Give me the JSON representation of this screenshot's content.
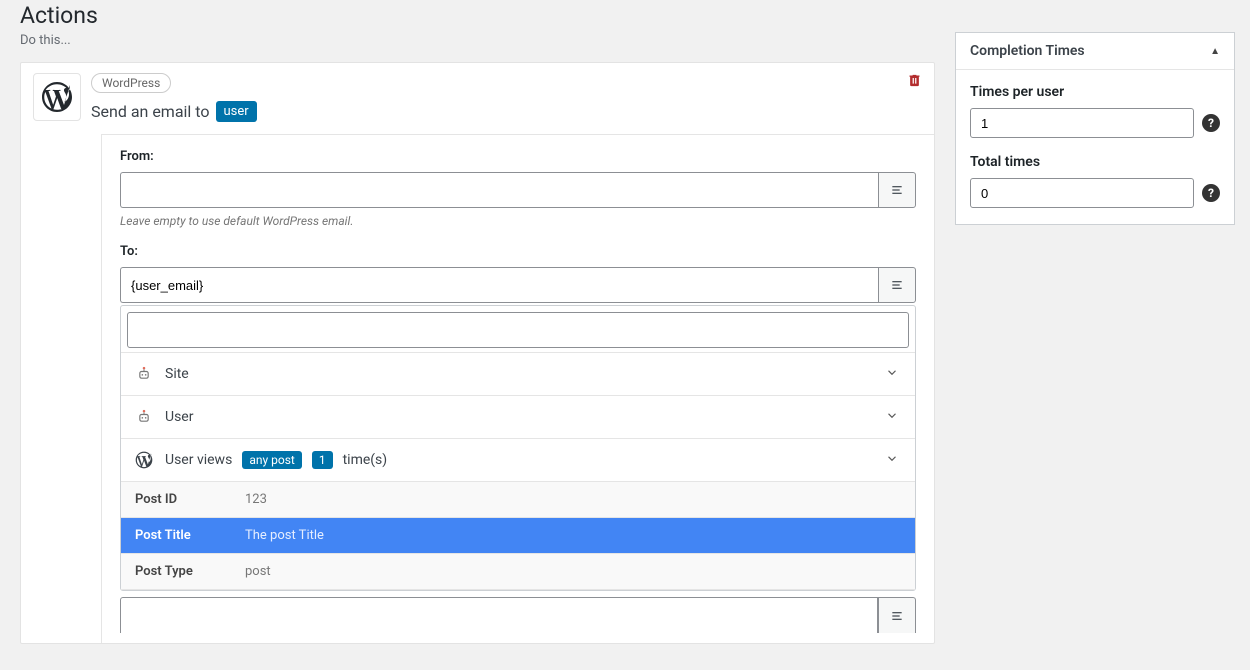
{
  "page": {
    "title": "Actions",
    "subtitle": "Do this..."
  },
  "action": {
    "integration_pill": "WordPress",
    "sentence_prefix": "Send an email to",
    "sentence_token": "user"
  },
  "from": {
    "label": "From:",
    "value": "",
    "hint": "Leave empty to use default WordPress email."
  },
  "to": {
    "label": "To:",
    "value": "{user_email}"
  },
  "dropdown": {
    "search_value": "",
    "groups": {
      "site": "Site",
      "user": "User",
      "views_prefix": "User views",
      "views_post_token": "any post",
      "views_count_token": "1",
      "views_suffix": "time(s)"
    },
    "rows": [
      {
        "key": "Post ID",
        "val": "123"
      },
      {
        "key": "Post Title",
        "val": "The post Title"
      },
      {
        "key": "Post Type",
        "val": "post"
      }
    ]
  },
  "sidebar": {
    "title": "Completion Times",
    "times_per_user": {
      "label": "Times per user",
      "value": "1"
    },
    "total_times": {
      "label": "Total times",
      "value": "0"
    }
  }
}
